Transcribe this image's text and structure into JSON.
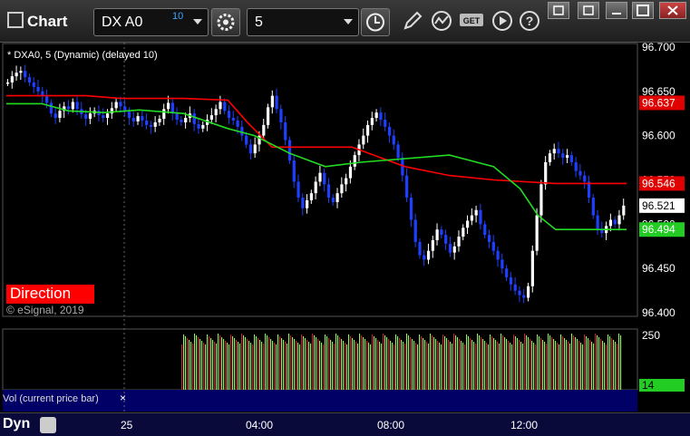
{
  "app": {
    "title": "Chart"
  },
  "toolbar": {
    "symbol": "DX A0",
    "symbol_superscript": "10",
    "interval": "5",
    "icons": [
      "gear-icon",
      "clock-icon",
      "pencil-icon",
      "study-icon",
      "get-icon",
      "play-icon",
      "help-icon"
    ]
  },
  "window_controls": [
    "restore-icon",
    "minimize-icon",
    "maximize-icon",
    "close-icon"
  ],
  "price_pane": {
    "label": "* DXA0, 5 (Dynamic) (delayed 10)",
    "badge": "Direction",
    "copyright": "© eSignal, 2019",
    "colors": {
      "up_bar": "#ffffff",
      "down_bar": "#1f3fff",
      "red_line": "#ff0000",
      "green_line": "#22dd22"
    }
  },
  "volume_pane": {
    "label": "Vol (current price bar)",
    "close": "×"
  },
  "bottom_bar": {
    "dyn": "Dyn",
    "time_labels": [
      "25",
      "04:00",
      "08:00",
      "12:00"
    ]
  },
  "chart_data": [
    {
      "type": "line",
      "ylim": [
        96.395,
        96.705
      ],
      "y_ticks": [
        "96.700",
        "96.650",
        "96.600",
        "96.550",
        "96.500",
        "96.450",
        "96.400"
      ],
      "x_labels": [
        "25",
        "04:00",
        "08:00",
        "12:00"
      ],
      "price_tags": [
        {
          "value": "96.637",
          "color": "#e00000"
        },
        {
          "value": "96.546",
          "color": "#e00000"
        },
        {
          "value": "96.521",
          "color": "#ffffff"
        },
        {
          "value": "96.494",
          "color": "#22cc22"
        }
      ],
      "candles": [
        96.66,
        96.667,
        96.671,
        96.673,
        96.666,
        96.66,
        96.655,
        96.65,
        96.645,
        96.637,
        96.625,
        96.62,
        96.628,
        96.633,
        96.63,
        96.638,
        96.63,
        96.624,
        96.619,
        96.625,
        96.628,
        96.623,
        96.62,
        96.625,
        96.631,
        96.638,
        96.633,
        96.627,
        96.62,
        96.616,
        96.622,
        96.617,
        96.612,
        96.61,
        96.615,
        96.619,
        96.63,
        96.637,
        96.625,
        96.618,
        96.615,
        96.62,
        96.625,
        96.613,
        96.608,
        96.612,
        96.618,
        96.623,
        96.63,
        96.638,
        96.628,
        96.62,
        96.617,
        96.61,
        96.6,
        96.59,
        96.58,
        96.59,
        96.6,
        96.612,
        96.632,
        96.645,
        96.63,
        96.615,
        96.595,
        96.572,
        96.548,
        96.53,
        96.518,
        96.527,
        96.535,
        96.548,
        96.558,
        96.545,
        96.53,
        96.525,
        96.535,
        96.545,
        96.552,
        96.565,
        96.578,
        96.59,
        96.6,
        96.612,
        96.62,
        96.626,
        96.618,
        96.61,
        96.6,
        96.59,
        96.575,
        96.555,
        96.53,
        96.505,
        96.48,
        96.465,
        96.46,
        96.47,
        96.482,
        96.494,
        96.488,
        96.478,
        96.468,
        96.475,
        96.486,
        96.496,
        96.504,
        96.51,
        96.516,
        96.5,
        96.488,
        96.48,
        96.47,
        96.46,
        96.45,
        96.44,
        96.432,
        96.425,
        96.42,
        96.417,
        96.43,
        96.47,
        96.51,
        96.545,
        96.57,
        96.58,
        96.585,
        96.58,
        96.575,
        96.578,
        96.57,
        96.56,
        96.555,
        96.548,
        96.53,
        96.51,
        96.495,
        96.49,
        96.498,
        96.505,
        96.5,
        96.51,
        96.521
      ],
      "red_line": [
        [
          0,
          96.645
        ],
        [
          45,
          96.645
        ],
        [
          65,
          96.642
        ],
        [
          100,
          96.642
        ],
        [
          125,
          96.64
        ],
        [
          136,
          96.615
        ],
        [
          150,
          96.587
        ],
        [
          195,
          96.587
        ],
        [
          225,
          96.565
        ],
        [
          250,
          96.555
        ],
        [
          275,
          96.55
        ],
        [
          310,
          96.546
        ],
        [
          350,
          96.546
        ]
      ],
      "green_line": [
        [
          0,
          96.636
        ],
        [
          20,
          96.636
        ],
        [
          35,
          96.628
        ],
        [
          55,
          96.626
        ],
        [
          75,
          96.629
        ],
        [
          100,
          96.625
        ],
        [
          125,
          96.608
        ],
        [
          140,
          96.6
        ],
        [
          160,
          96.58
        ],
        [
          180,
          96.565
        ],
        [
          200,
          96.57
        ],
        [
          250,
          96.578
        ],
        [
          275,
          96.565
        ],
        [
          290,
          96.54
        ],
        [
          300,
          96.51
        ],
        [
          310,
          96.494
        ],
        [
          350,
          96.494
        ]
      ],
      "volume": {
        "y_ticks": [
          "250"
        ],
        "current_tag": "14",
        "start_index": 100,
        "bars_count": 243
      }
    }
  ]
}
